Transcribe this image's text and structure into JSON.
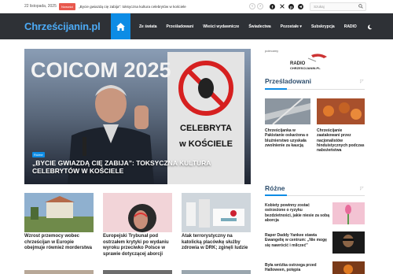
{
  "topbar": {
    "date": "22 listopada, 2025",
    "badge": "Nowości",
    "ticker": "„Bycie gwiazdą cię zabija”: toksyczna kultura celebrytów w kościele",
    "search_placeholder": "Szukaj"
  },
  "nav": {
    "logo": "Chrześcijanin.pl",
    "items": [
      "Ze świata",
      "Prześladowani",
      "Wieści wydawnicze",
      "Świadectwa",
      "Pozostałe ▾",
      "Subskrypcja",
      "RADIO"
    ]
  },
  "hero": {
    "badge": "Różne",
    "title": "„Bycie gwiazdą cię zabija”: toksyczna kultura celebrytów w kościele",
    "photo_text": "COICOM 2025",
    "sign_text_1": "CELEBRYTA",
    "sign_text_2": "w KOŚCIELE"
  },
  "sidebar": {
    "recommended_label": "polecamy",
    "radio_logo_text_1": "RADIO",
    "radio_logo_text_2": "CHRZESCIJANIN.PL",
    "section1_title": "Prześladowani",
    "persecuted": [
      {
        "title": "Chrześcijanka w Pakistanie oskarżona o bluźnierstwo uzyskała zwolnienie za kaucją"
      },
      {
        "title": "Chrześcijanie zaatakowani przez nacjonalistów hinduistycznych podczas nabożeństwa"
      }
    ],
    "section2_title": "Różne",
    "various": [
      {
        "title": "Kobiety powinny zostać ostrzeżone o ryzyku bezdzietności, jakie niesie za sobą aborcja"
      },
      {
        "title": "Raper Daddy Yankee stawia Ewangelię w centrum: „Nie mogę się nawrócić i milczeć”"
      },
      {
        "title": "Była wróżka ostrzega przed Halloween, potępia"
      }
    ]
  },
  "cards": [
    {
      "title": "Wzrost przemocy wobec chrześcijan w Europie obejmuje również morderstwa"
    },
    {
      "title": "Europejski Trybunał pod ostrzałem krytyki po wydaniu wyroku przeciwko Polsce w sprawie dotyczącej aborcji"
    },
    {
      "title": "Atak terrorystyczny na katolicką placówkę służby zdrowia w DRK; zginęli ludzie"
    }
  ],
  "colors": {
    "accent": "#0d8ce5",
    "nav_bg": "#2e3136",
    "badge_red": "#e8584d",
    "logo_blue": "#4caaf5"
  }
}
